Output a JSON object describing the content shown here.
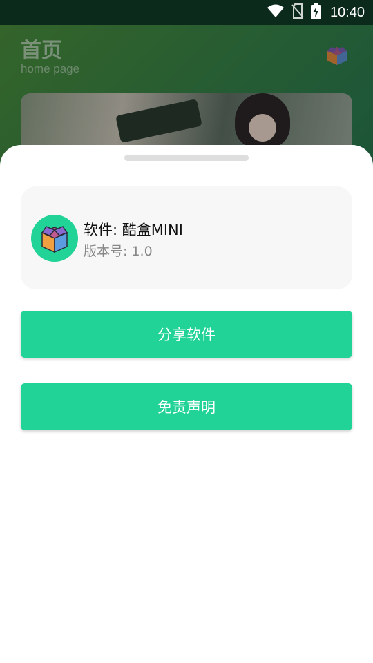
{
  "status_bar": {
    "time": "10:40",
    "icons": [
      "wifi-icon",
      "no-sim-icon",
      "battery-charging-icon"
    ]
  },
  "home": {
    "title": "首页",
    "subtitle": "home page",
    "icon": "box-icon"
  },
  "sheet": {
    "app_name": "软件: 酷盒MINI",
    "app_version": "版本号: 1.0",
    "share_button": "分享软件",
    "disclaimer_button": "免责声明"
  },
  "colors": {
    "accent": "#22d398",
    "status_bar": "#0b2a1c",
    "sheet_background": "#ffffff",
    "card_background": "#f7f7f7"
  }
}
